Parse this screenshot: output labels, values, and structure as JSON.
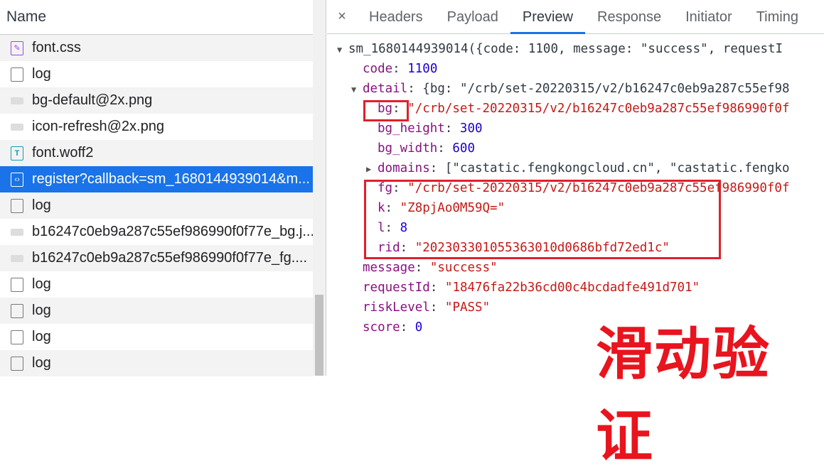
{
  "network": {
    "header": "Name",
    "rows": [
      {
        "name": "font.css",
        "icon": "css"
      },
      {
        "name": "log",
        "icon": "doc"
      },
      {
        "name": "bg-default@2x.png",
        "icon": "img"
      },
      {
        "name": "icon-refresh@2x.png",
        "icon": "img"
      },
      {
        "name": "font.woff2",
        "icon": "font"
      },
      {
        "name": "register?callback=sm_1680144939014&m...",
        "icon": "xhr",
        "selected": true
      },
      {
        "name": "log",
        "icon": "doc"
      },
      {
        "name": "b16247c0eb9a287c55ef986990f0f77e_bg.j...",
        "icon": "img"
      },
      {
        "name": "b16247c0eb9a287c55ef986990f0f77e_fg....",
        "icon": "img"
      },
      {
        "name": "log",
        "icon": "doc"
      },
      {
        "name": "log",
        "icon": "doc"
      },
      {
        "name": "log",
        "icon": "doc"
      },
      {
        "name": "log",
        "icon": "doc"
      }
    ]
  },
  "tabs": {
    "close": "×",
    "items": [
      "Headers",
      "Payload",
      "Preview",
      "Response",
      "Initiator",
      "Timing"
    ],
    "active": "Preview"
  },
  "preview": {
    "root": "sm_1680144939014({code: 1100, message: \"success\", requestI",
    "code_k": "code",
    "code_v": "1100",
    "detail_k": "detail",
    "detail_v": "{bg: \"/crb/set-20220315/v2/b16247c0eb9a287c55ef98",
    "bg_k": "bg",
    "bg_v": "\"/crb/set-20220315/v2/b16247c0eb9a287c55ef986990f0f",
    "bgh_k": "bg_height",
    "bgh_v": "300",
    "bgw_k": "bg_width",
    "bgw_v": "600",
    "dom_k": "domains",
    "dom_v": "[\"castatic.fengkongcloud.cn\", \"castatic.fengko",
    "fg_k": "fg",
    "fg_v": "\"/crb/set-20220315/v2/b16247c0eb9a287c55ef986990f0f",
    "k_k": "k",
    "k_v": "\"Z8pjAo0M59Q=\"",
    "l_k": "l",
    "l_v": "8",
    "rid_k": "rid",
    "rid_v": "\"202303301055363010d0686bfd72ed1c\"",
    "msg_k": "message",
    "msg_v": "\"success\"",
    "req_k": "requestId",
    "req_v": "\"18476fa22b36cd00c4bcdadfe491d701\"",
    "risk_k": "riskLevel",
    "risk_v": "\"PASS\"",
    "score_k": "score",
    "score_v": "0"
  },
  "overlay": "滑动验证"
}
